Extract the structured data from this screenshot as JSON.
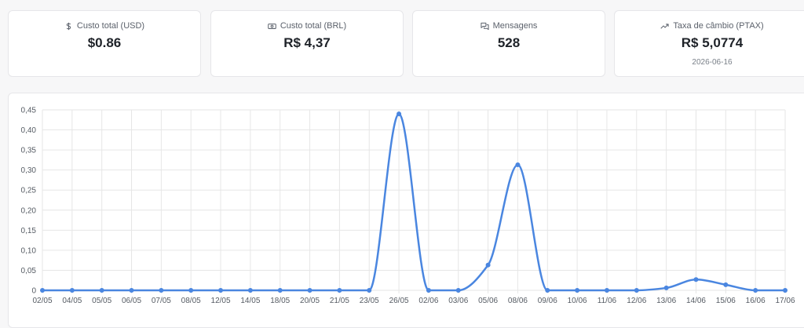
{
  "cards": [
    {
      "id": "usd",
      "icon": "dollar-icon",
      "label": "Custo total (USD)",
      "value": "$0.86"
    },
    {
      "id": "brl",
      "icon": "banknote-icon",
      "label": "Custo total (BRL)",
      "value": "R$ 4,37"
    },
    {
      "id": "msg",
      "icon": "messages-icon",
      "label": "Mensagens",
      "value": "528"
    },
    {
      "id": "ptax",
      "icon": "trending-up-icon",
      "label": "Taxa de câmbio (PTAX)",
      "value": "R$ 5,0774",
      "sub": "2026-06-16"
    }
  ],
  "colors": {
    "line": "#4a86e0",
    "grid": "#e6e6e6",
    "accent": "#4a86e0"
  },
  "chart_data": {
    "type": "line",
    "categories": [
      "02/05",
      "04/05",
      "05/05",
      "06/05",
      "07/05",
      "08/05",
      "12/05",
      "14/05",
      "18/05",
      "20/05",
      "21/05",
      "23/05",
      "26/05",
      "02/06",
      "03/06",
      "05/06",
      "08/06",
      "09/06",
      "10/06",
      "11/06",
      "12/06",
      "13/06",
      "14/06",
      "15/06",
      "16/06",
      "17/06"
    ],
    "values": [
      0,
      0,
      0,
      0,
      0,
      0,
      0,
      0,
      0,
      0,
      0,
      0,
      0.44,
      0,
      0,
      0.063,
      0.313,
      0,
      0,
      0,
      0,
      0.006,
      0.027,
      0.014,
      0,
      0
    ],
    "ylim": [
      0,
      0.45
    ],
    "yticks": [
      "0",
      "0,05",
      "0,10",
      "0,15",
      "0,20",
      "0,25",
      "0,30",
      "0,35",
      "0,40",
      "0,45"
    ],
    "grid": true,
    "smooth": true
  }
}
